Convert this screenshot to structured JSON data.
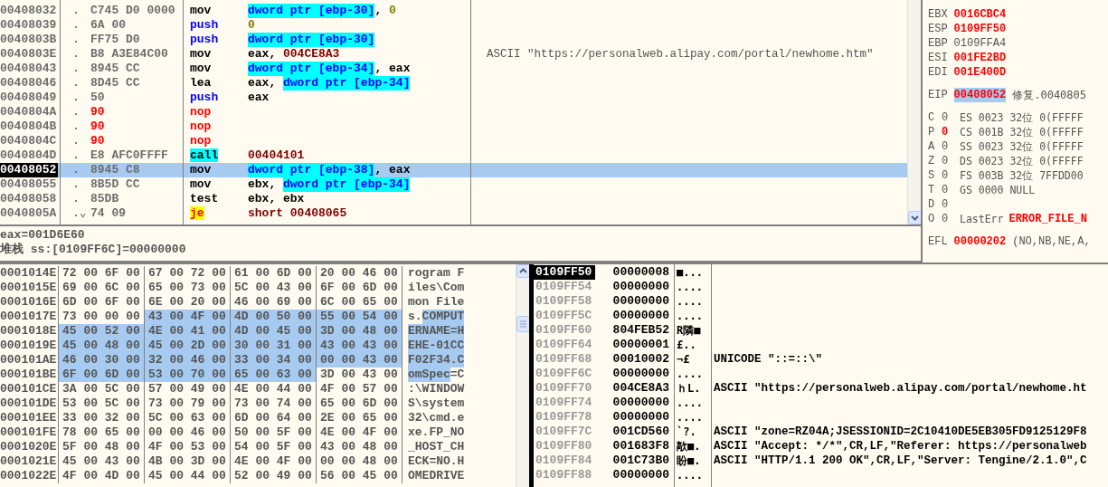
{
  "disassembly": {
    "rows": [
      {
        "address": "00408032",
        "marker": ".",
        "bytes": "C745 D0 0000",
        "patched": false,
        "mnemonic": {
          "text": "mov",
          "kind": "plain"
        },
        "operands": [
          {
            "text": "dword ptr [ebp-30]",
            "kind": "mem"
          },
          {
            "text": ", ",
            "kind": "sep"
          },
          {
            "text": "0",
            "kind": "imm"
          }
        ],
        "comment": "",
        "selected": false,
        "current": false
      },
      {
        "address": "00408039",
        "marker": ".",
        "bytes": "6A 00",
        "patched": false,
        "mnemonic": {
          "text": "push",
          "kind": "stack"
        },
        "operands": [
          {
            "text": "0",
            "kind": "imm"
          }
        ],
        "comment": "",
        "selected": false,
        "current": false
      },
      {
        "address": "0040803B",
        "marker": ".",
        "bytes": "FF75 D0",
        "patched": false,
        "mnemonic": {
          "text": "push",
          "kind": "stack"
        },
        "operands": [
          {
            "text": "dword ptr [ebp-30]",
            "kind": "mem"
          }
        ],
        "comment": "",
        "selected": false,
        "current": false
      },
      {
        "address": "0040803E",
        "marker": ".",
        "bytes": "B8 A3E84C00",
        "patched": false,
        "mnemonic": {
          "text": "mov",
          "kind": "plain"
        },
        "operands": [
          {
            "text": "eax",
            "kind": "reg"
          },
          {
            "text": ", ",
            "kind": "sep"
          },
          {
            "text": "004CE8A3",
            "kind": "addr"
          }
        ],
        "comment": "ASCII \"https://personalweb.alipay.com/portal/newhome.htm\"",
        "selected": false,
        "current": false
      },
      {
        "address": "00408043",
        "marker": ".",
        "bytes": "8945 CC",
        "patched": false,
        "mnemonic": {
          "text": "mov",
          "kind": "plain"
        },
        "operands": [
          {
            "text": "dword ptr [ebp-34]",
            "kind": "mem"
          },
          {
            "text": ", ",
            "kind": "sep"
          },
          {
            "text": "eax",
            "kind": "reg"
          }
        ],
        "comment": "",
        "selected": false,
        "current": false
      },
      {
        "address": "00408046",
        "marker": ".",
        "bytes": "8D45 CC",
        "patched": false,
        "mnemonic": {
          "text": "lea",
          "kind": "plain"
        },
        "operands": [
          {
            "text": "eax",
            "kind": "reg"
          },
          {
            "text": ", ",
            "kind": "sep"
          },
          {
            "text": "dword ptr [ebp-34]",
            "kind": "mem"
          }
        ],
        "comment": "",
        "selected": false,
        "current": false
      },
      {
        "address": "00408049",
        "marker": ".",
        "bytes": "50",
        "patched": false,
        "mnemonic": {
          "text": "push",
          "kind": "stack"
        },
        "operands": [
          {
            "text": "eax",
            "kind": "reg"
          }
        ],
        "comment": "",
        "selected": false,
        "current": false
      },
      {
        "address": "0040804A",
        "marker": ".",
        "bytes": "90",
        "patched": true,
        "mnemonic": {
          "text": "nop",
          "kind": "nop"
        },
        "operands": [],
        "comment": "",
        "selected": false,
        "current": false
      },
      {
        "address": "0040804B",
        "marker": ".",
        "bytes": "90",
        "patched": true,
        "mnemonic": {
          "text": "nop",
          "kind": "nop"
        },
        "operands": [],
        "comment": "",
        "selected": false,
        "current": false
      },
      {
        "address": "0040804C",
        "marker": ".",
        "bytes": "90",
        "patched": true,
        "mnemonic": {
          "text": "nop",
          "kind": "nop"
        },
        "operands": [],
        "comment": "",
        "selected": false,
        "current": false
      },
      {
        "address": "0040804D",
        "marker": ".",
        "bytes": "E8 AFC0FFFF",
        "patched": false,
        "mnemonic": {
          "text": "call",
          "kind": "call"
        },
        "operands": [
          {
            "text": "00404101",
            "kind": "addr"
          }
        ],
        "comment": "",
        "selected": false,
        "current": false
      },
      {
        "address": "00408052",
        "marker": ".",
        "bytes": "8945 C8",
        "patched": false,
        "mnemonic": {
          "text": "mov",
          "kind": "plain"
        },
        "operands": [
          {
            "text": "dword ptr [ebp-38]",
            "kind": "mem"
          },
          {
            "text": ", ",
            "kind": "sep"
          },
          {
            "text": "eax",
            "kind": "reg"
          }
        ],
        "comment": "",
        "selected": true,
        "current": true
      },
      {
        "address": "00408055",
        "marker": ".",
        "bytes": "8B5D CC",
        "patched": false,
        "mnemonic": {
          "text": "mov",
          "kind": "plain"
        },
        "operands": [
          {
            "text": "ebx",
            "kind": "reg"
          },
          {
            "text": ", ",
            "kind": "sep"
          },
          {
            "text": "dword ptr [ebp-34]",
            "kind": "mem"
          }
        ],
        "comment": "",
        "selected": false,
        "current": false
      },
      {
        "address": "00408058",
        "marker": ".",
        "bytes": "85DB",
        "patched": false,
        "mnemonic": {
          "text": "test",
          "kind": "plain"
        },
        "operands": [
          {
            "text": "ebx",
            "kind": "reg"
          },
          {
            "text": ", ",
            "kind": "sep"
          },
          {
            "text": "ebx",
            "kind": "reg"
          }
        ],
        "comment": "",
        "selected": false,
        "current": false
      },
      {
        "address": "0040805A",
        "marker": ".⌄",
        "bytes": "74 09",
        "patched": false,
        "mnemonic": {
          "text": "je",
          "kind": "jump"
        },
        "operands": [
          {
            "text": "short ",
            "kind": "jumpword"
          },
          {
            "text": "00408065",
            "kind": "addr"
          }
        ],
        "comment": "",
        "selected": false,
        "current": false
      }
    ]
  },
  "info": {
    "lines": [
      "eax=001D6E60",
      "堆栈 ss:[0109FF6C]=00000000"
    ]
  },
  "registers": {
    "general": [
      {
        "name": "EBX",
        "value": "0016CBC4",
        "changed": true
      },
      {
        "name": "ESP",
        "value": "0109FF50",
        "changed": true
      },
      {
        "name": "EBP",
        "value": "0109FFA4",
        "changed": false
      },
      {
        "name": "ESI",
        "value": "001FE2BD",
        "changed": true
      },
      {
        "name": "EDI",
        "value": "001E400D",
        "changed": true
      }
    ],
    "eip": {
      "name": "EIP",
      "value": "00408052",
      "highlighted": true,
      "comment": "修复.0040805"
    },
    "flags": [
      {
        "flag": "C",
        "bit": "0",
        "changed": false,
        "detail": "ES 0023 32位 0(FFFFF"
      },
      {
        "flag": "P",
        "bit": "0",
        "changed": true,
        "detail": "CS 001B 32位 0(FFFFF"
      },
      {
        "flag": "A",
        "bit": "0",
        "changed": false,
        "detail": "SS 0023 32位 0(FFFFF"
      },
      {
        "flag": "Z",
        "bit": "0",
        "changed": false,
        "detail": "DS 0023 32位 0(FFFFF"
      },
      {
        "flag": "S",
        "bit": "0",
        "changed": false,
        "detail": "FS 003B 32位 7FFDD00"
      },
      {
        "flag": "T",
        "bit": "0",
        "changed": false,
        "detail": "GS 0000 NULL"
      },
      {
        "flag": "D",
        "bit": "0",
        "changed": false
      },
      {
        "flag": "O",
        "bit": "0",
        "changed": false,
        "detail": "LastErr",
        "error_text": "ERROR_FILE_N"
      }
    ],
    "efl": {
      "name": "EFL",
      "value": "00000202",
      "changed": true,
      "detail": "(NO,NB,NE,A,"
    }
  },
  "dump": {
    "rows": [
      {
        "address": "0001014E",
        "hex": [
          {
            "text": "72 00 6F 00",
            "selected": false
          },
          {
            "text": "67 00 72 00",
            "selected": false
          },
          {
            "text": "61 00 6D 00",
            "selected": false
          },
          {
            "text": "20 00 46 00",
            "selected": false
          }
        ],
        "ascii": [
          {
            "text": "rogram F",
            "selected": false
          }
        ]
      },
      {
        "address": "0001015E",
        "hex": [
          {
            "text": "69 00 6C 00",
            "selected": false
          },
          {
            "text": "65 00 73 00",
            "selected": false
          },
          {
            "text": "5C 00 43 00",
            "selected": false
          },
          {
            "text": "6F 00 6D 00",
            "selected": false
          }
        ],
        "ascii": [
          {
            "text": "iles\\Com",
            "selected": false
          }
        ]
      },
      {
        "address": "0001016E",
        "hex": [
          {
            "text": "6D 00 6F 00",
            "selected": false
          },
          {
            "text": "6E 00 20 00",
            "selected": false
          },
          {
            "text": "46 00 69 00",
            "selected": false
          },
          {
            "text": "6C 00 65 00",
            "selected": false
          }
        ],
        "ascii": [
          {
            "text": "mon File",
            "selected": false
          }
        ]
      },
      {
        "address": "0001017E",
        "hex": [
          {
            "text": "73 00 00 00",
            "selected": false
          },
          {
            "text": "43 00 4F 00",
            "selected": true
          },
          {
            "text": "4D 00 50 00",
            "selected": true
          },
          {
            "text": "55 00 54 00",
            "selected": true
          }
        ],
        "ascii": [
          {
            "text": "s.",
            "selected": false
          },
          {
            "text": "COMPUT",
            "selected": true
          }
        ]
      },
      {
        "address": "0001018E",
        "hex": [
          {
            "text": "45 00 52 00",
            "selected": true
          },
          {
            "text": "4E 00 41 00",
            "selected": true
          },
          {
            "text": "4D 00 45 00",
            "selected": true
          },
          {
            "text": "3D 00 48 00",
            "selected": true
          }
        ],
        "ascii": [
          {
            "text": "ERNAME=H",
            "selected": true
          }
        ]
      },
      {
        "address": "0001019E",
        "hex": [
          {
            "text": "45 00 48 00",
            "selected": true
          },
          {
            "text": "45 00 2D 00",
            "selected": true
          },
          {
            "text": "30 00 31 00",
            "selected": true
          },
          {
            "text": "43 00 43 00",
            "selected": true
          }
        ],
        "ascii": [
          {
            "text": "EHE-01CC",
            "selected": true
          }
        ]
      },
      {
        "address": "000101AE",
        "hex": [
          {
            "text": "46 00 30 00",
            "selected": true
          },
          {
            "text": "32 00 46 00",
            "selected": true
          },
          {
            "text": "33 00 34 00",
            "selected": true
          },
          {
            "text": "00 00 43 00",
            "selected": true
          }
        ],
        "ascii": [
          {
            "text": "F02F34.C",
            "selected": true
          }
        ]
      },
      {
        "address": "000101BE",
        "hex": [
          {
            "text": "6F 00 6D 00",
            "selected": true
          },
          {
            "text": "53 00 70 00",
            "selected": true
          },
          {
            "text": "65 00 63 00",
            "selected": true
          },
          {
            "text": "3D 00 43 00",
            "selected": false
          }
        ],
        "ascii": [
          {
            "text": "omSpec",
            "selected": true
          },
          {
            "text": "=C",
            "selected": false
          }
        ]
      },
      {
        "address": "000101CE",
        "hex": [
          {
            "text": "3A 00 5C 00",
            "selected": false
          },
          {
            "text": "57 00 49 00",
            "selected": false
          },
          {
            "text": "4E 00 44 00",
            "selected": false
          },
          {
            "text": "4F 00 57 00",
            "selected": false
          }
        ],
        "ascii": [
          {
            "text": ":\\WINDOW",
            "selected": false
          }
        ]
      },
      {
        "address": "000101DE",
        "hex": [
          {
            "text": "53 00 5C 00",
            "selected": false
          },
          {
            "text": "73 00 79 00",
            "selected": false
          },
          {
            "text": "73 00 74 00",
            "selected": false
          },
          {
            "text": "65 00 6D 00",
            "selected": false
          }
        ],
        "ascii": [
          {
            "text": "S\\system",
            "selected": false
          }
        ]
      },
      {
        "address": "000101EE",
        "hex": [
          {
            "text": "33 00 32 00",
            "selected": false
          },
          {
            "text": "5C 00 63 00",
            "selected": false
          },
          {
            "text": "6D 00 64 00",
            "selected": false
          },
          {
            "text": "2E 00 65 00",
            "selected": false
          }
        ],
        "ascii": [
          {
            "text": "32\\cmd.e",
            "selected": false
          }
        ]
      },
      {
        "address": "000101FE",
        "hex": [
          {
            "text": "78 00 65 00",
            "selected": false
          },
          {
            "text": "00 00 46 00",
            "selected": false
          },
          {
            "text": "50 00 5F 00",
            "selected": false
          },
          {
            "text": "4E 00 4F 00",
            "selected": false
          }
        ],
        "ascii": [
          {
            "text": "xe.FP_NO",
            "selected": false
          }
        ]
      },
      {
        "address": "0001020E",
        "hex": [
          {
            "text": "5F 00 48 00",
            "selected": false
          },
          {
            "text": "4F 00 53 00",
            "selected": false
          },
          {
            "text": "54 00 5F 00",
            "selected": false
          },
          {
            "text": "43 00 48 00",
            "selected": false
          }
        ],
        "ascii": [
          {
            "text": "_HOST_CH",
            "selected": false
          }
        ]
      },
      {
        "address": "0001021E",
        "hex": [
          {
            "text": "45 00 43 00",
            "selected": false
          },
          {
            "text": "4B 00 3D 00",
            "selected": false
          },
          {
            "text": "4E 00 4F 00",
            "selected": false
          },
          {
            "text": "00 00 48 00",
            "selected": false
          }
        ],
        "ascii": [
          {
            "text": "ECK=NO.H",
            "selected": false
          }
        ]
      },
      {
        "address": "0001022E",
        "hex": [
          {
            "text": "4F 00 4D 00",
            "selected": false
          },
          {
            "text": "45 00 44 00",
            "selected": false
          },
          {
            "text": "52 00 49 00",
            "selected": false
          },
          {
            "text": "56 00 45 00",
            "selected": false
          }
        ],
        "ascii": [
          {
            "text": "OMEDRIVE",
            "selected": false
          }
        ]
      }
    ]
  },
  "stack": {
    "rows": [
      {
        "address": "0109FF50",
        "value": "00000008",
        "ascii": "■...",
        "comment": "",
        "selected": true
      },
      {
        "address": "0109FF54",
        "value": "00000000",
        "ascii": "....",
        "comment": "",
        "selected": false
      },
      {
        "address": "0109FF58",
        "value": "00000000",
        "ascii": "....",
        "comment": "",
        "selected": false
      },
      {
        "address": "0109FF5C",
        "value": "00000000",
        "ascii": "....",
        "comment": "",
        "selected": false
      },
      {
        "address": "0109FF60",
        "value": "804FEB52",
        "ascii": "R隣■",
        "comment": "",
        "selected": false
      },
      {
        "address": "0109FF64",
        "value": "00000001",
        "ascii": "£..",
        "comment": "",
        "selected": false
      },
      {
        "address": "0109FF68",
        "value": "00010002",
        "ascii": "¬£",
        "comment": "UNICODE \"::=::\\\"",
        "selected": false
      },
      {
        "address": "0109FF6C",
        "value": "00000000",
        "ascii": "....",
        "comment": "",
        "selected": false
      },
      {
        "address": "0109FF70",
        "value": "004CE8A3",
        "ascii": "ｈL.",
        "comment": "ASCII \"https://personalweb.alipay.com/portal/newhome.ht",
        "selected": false
      },
      {
        "address": "0109FF74",
        "value": "00000000",
        "ascii": "....",
        "comment": "",
        "selected": false
      },
      {
        "address": "0109FF78",
        "value": "00000000",
        "ascii": "....",
        "comment": "",
        "selected": false
      },
      {
        "address": "0109FF7C",
        "value": "001CD560",
        "ascii": "`?.",
        "comment": "ASCII \"zone=RZ04A;JSESSIONID=2C10410DE5EB305FD9125129F8",
        "selected": false
      },
      {
        "address": "0109FF80",
        "value": "001683F8",
        "ascii": "歊■.",
        "comment": "ASCII \"Accept: */*\",CR,LF,\"Referer: https://personalweb",
        "selected": false
      },
      {
        "address": "0109FF84",
        "value": "001C73B0",
        "ascii": "盼■.",
        "comment": "ASCII \"HTTP/1.1 200 OK\",CR,LF,\"Server: Tengine/2.1.0\",C",
        "selected": false
      },
      {
        "address": "0109FF88",
        "value": "00000000",
        "ascii": "....",
        "comment": "",
        "selected": false
      }
    ]
  }
}
